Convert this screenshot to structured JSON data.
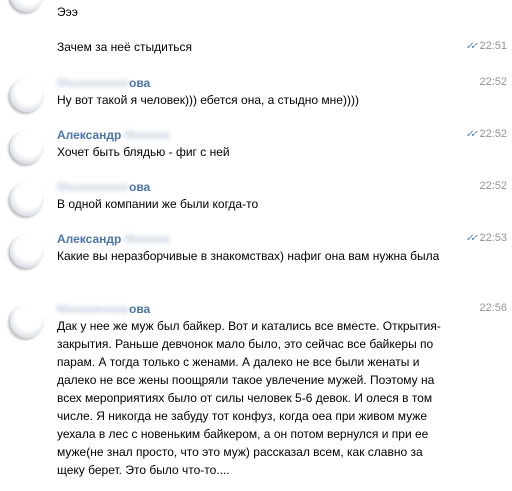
{
  "messages": [
    {
      "author": "",
      "text": "Эээ",
      "time": ""
    },
    {
      "author": "",
      "text": "Зачем за неё стыдиться",
      "time": "22:51",
      "read": true
    },
    {
      "author": "ова",
      "text": "Ну вот такой я человек))) ебется она, а стыдно мне))))",
      "time": "22:52",
      "read": false
    },
    {
      "author": "Александр",
      "text": "Хочет быть блядью  -  фиг с ней",
      "time": "22:52",
      "read": true
    },
    {
      "author": "ова",
      "text": "В одной компании же были когда-то",
      "time": "22:52",
      "read": false
    },
    {
      "author": "Александр",
      "text": "Какие вы неразборчивые в знакомствах)  нафиг она вам нужна была",
      "time": "22:53",
      "read": true
    },
    {
      "author": "ова",
      "text": "Дак у нее же муж был байкер. Вот и катались все вместе. Открытия-закрытия. Раньше девчонок мало было, это сейчас все байкеры по парам. А тогда только с женами. А далеко не все были женаты и далеко не все жены поощряли такое увлечение мужей. Поэтому на всех мероприятиях было от силы человек 5-6 девок. И олеся в том числе. Я никогда не забуду тот конфуз, когда оеа при живом муже уехала в лес с новеньким байкером, а он потом вернулся и при ее муже(не знал просто, что это муж) рассказал всем, как славно за щеку берет. Это было что-то....",
      "time": "22:56",
      "read": false
    }
  ],
  "read_check": "✓✓",
  "colors": {
    "author": "#4a76a8",
    "time": "#939393",
    "check": "#5181b8"
  }
}
